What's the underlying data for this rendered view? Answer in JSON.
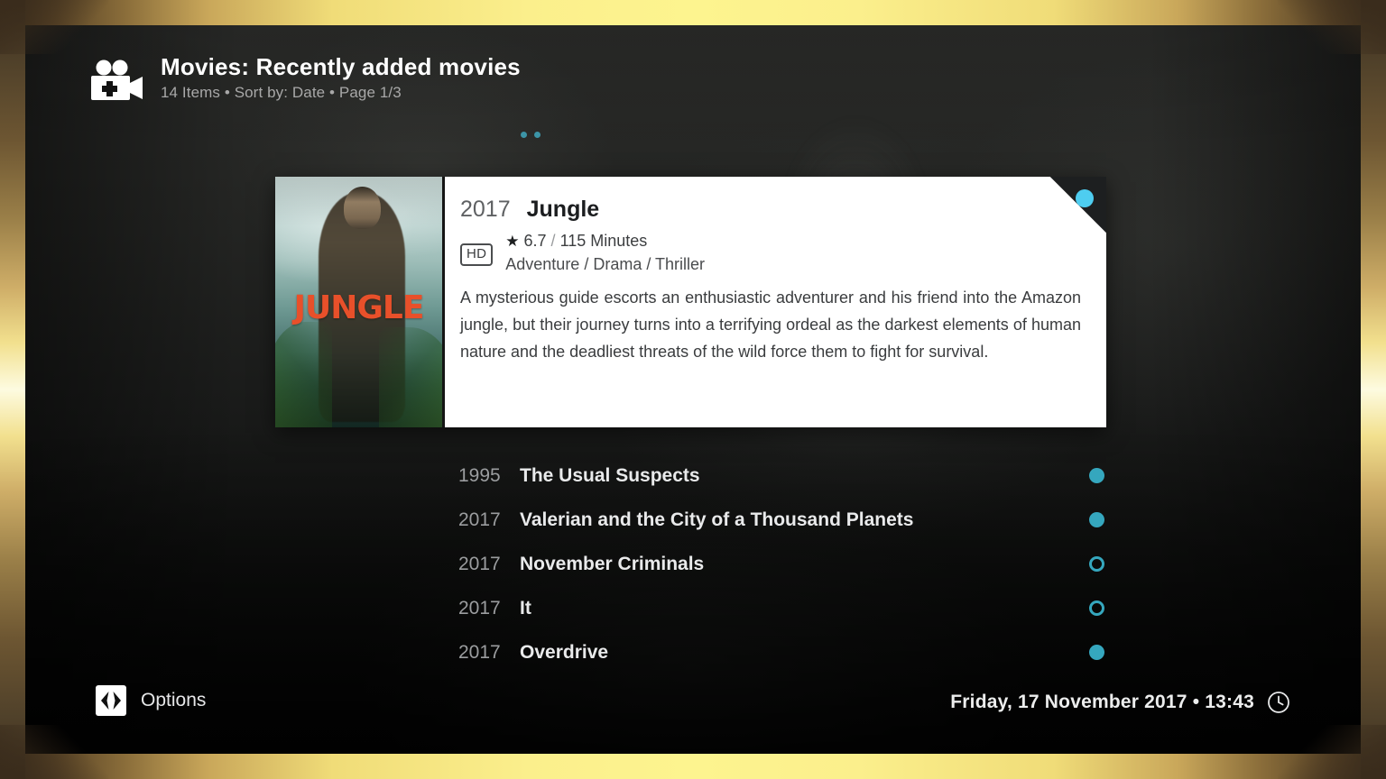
{
  "header": {
    "icon": "movie-camera-add-icon",
    "title": "Movies: Recently added movies",
    "subtitle": "14 Items • Sort by: Date • Page 1/3",
    "item_count": "14 Items",
    "sort_by": "Sort by: Date",
    "page": "Page 1/3"
  },
  "focused_movie": {
    "year": "2017",
    "title": "Jungle",
    "quality_badge": "HD",
    "rating": "6.7",
    "rating_separator": "/",
    "duration": "115 Minutes",
    "rating_line": "6.7 / 115 Minutes",
    "genres": "Adventure / Drama / Thriller",
    "plot": "A mysterious guide escorts an enthusiastic adventurer and his friend into the Amazon jungle, but their journey turns into a terrifying ordeal as the darkest elements of human nature and the deadliest threats of the wild force them to fight for survival.",
    "poster_text": "JUNGLE",
    "watched": true,
    "star_glyph": "★"
  },
  "list": {
    "items": [
      {
        "year": "1995",
        "title": "The Usual Suspects",
        "watched": true
      },
      {
        "year": "2017",
        "title": "Valerian and the City of a Thousand Planets",
        "watched": true
      },
      {
        "year": "2017",
        "title": "November Criminals",
        "watched": false
      },
      {
        "year": "2017",
        "title": "It",
        "watched": false
      },
      {
        "year": "2017",
        "title": "Overdrive",
        "watched": true
      }
    ]
  },
  "footer": {
    "options_label": "Options",
    "options_icon": "left-right-arrows-icon",
    "datetime": "Friday, 17 November 2017 • 13:43",
    "date": "Friday, 17 November 2017",
    "time": "13:43",
    "clock_icon": "clock-icon"
  },
  "colors": {
    "accent_teal": "#35a7be",
    "accent_cyan": "#4ecdf0",
    "card_background": "#ffffff",
    "bezel_gold": "#fdf48f",
    "poster_title_orange": "#e8502a"
  }
}
